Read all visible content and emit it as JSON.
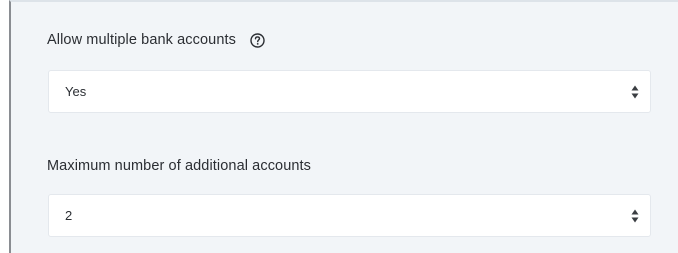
{
  "fields": [
    {
      "label": "Allow multiple bank accounts",
      "help_icon": "question-circle-icon",
      "value": "Yes",
      "control": "select"
    },
    {
      "label": "Maximum number of additional accounts",
      "value": "2",
      "control": "select"
    }
  ],
  "colors": {
    "panel_background": "#f2f5f8",
    "input_background": "#ffffff",
    "text": "#2b2e33",
    "border": "#e4e8ed"
  }
}
